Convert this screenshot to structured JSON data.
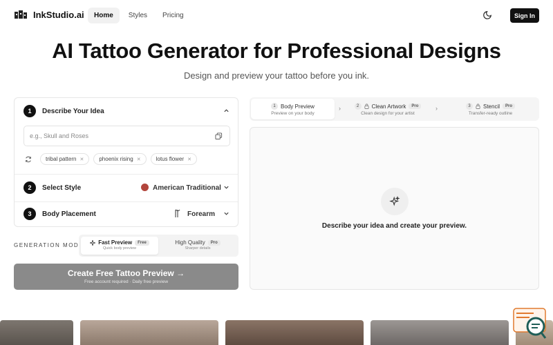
{
  "brand": {
    "name": "InkStudio.ai"
  },
  "nav": {
    "items": [
      {
        "label": "Home",
        "active": true
      },
      {
        "label": "Styles",
        "active": false
      },
      {
        "label": "Pricing",
        "active": false
      }
    ]
  },
  "header": {
    "signin_label": "Sign In",
    "theme_icon": "moon-icon"
  },
  "hero": {
    "title": "AI Tattoo Generator for Professional Designs",
    "subtitle": "Design and preview your tattoo before you ink."
  },
  "steps": {
    "describe": {
      "num": "1",
      "label": "Describe Your Idea",
      "placeholder": "e.g., Skull and Roses",
      "chips": [
        "tribal pattern",
        "phoenix rising",
        "lotus flower"
      ]
    },
    "style": {
      "num": "2",
      "label": "Select Style",
      "value": "American Traditional"
    },
    "placement": {
      "num": "3",
      "label": "Body Placement",
      "value": "Forearm"
    }
  },
  "generation": {
    "label": "GENERATION MODE",
    "options": [
      {
        "name": "Fast Preview",
        "badge": "Free",
        "desc": "Quick body preview",
        "active": true
      },
      {
        "name": "High Quality",
        "badge": "Pro",
        "desc": "Sharper details",
        "active": false
      }
    ]
  },
  "cta": {
    "label": "Create Free Tattoo Preview",
    "arrow": "→",
    "sub": "Free account required · Daily free preview"
  },
  "output_tabs": [
    {
      "num": "1",
      "title": "Body Preview",
      "desc": "Preview on your body",
      "badge": "",
      "locked": false,
      "active": true
    },
    {
      "num": "2",
      "title": "Clean Artwork",
      "desc": "Clean design for your artist",
      "badge": "Pro",
      "locked": true,
      "active": false
    },
    {
      "num": "3",
      "title": "Stencil",
      "desc": "Transfer-ready outline",
      "badge": "Pro",
      "locked": true,
      "active": false
    }
  ],
  "preview": {
    "empty_text": "Describe your idea and create your preview."
  },
  "colors": {
    "primary": "#111111",
    "cta_disabled": "#8a8a8a",
    "muted": "#f3f3f3"
  }
}
